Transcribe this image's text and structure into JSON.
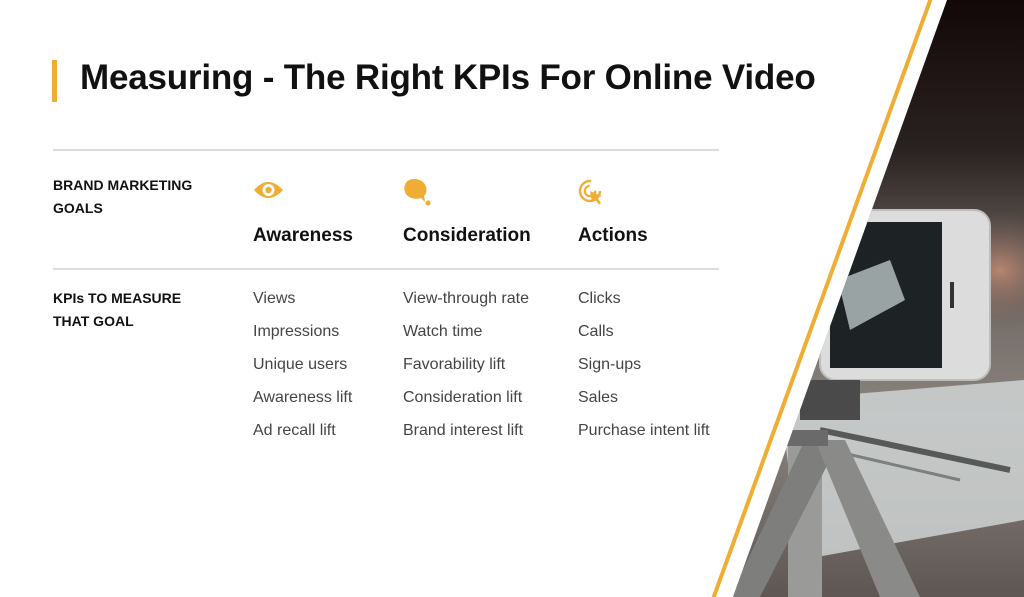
{
  "slide": {
    "title": "Measuring - The Right KPIs For Online Video",
    "accent_color": "#f0ad33"
  },
  "rows": {
    "goals_label": [
      "BRAND MARKETING",
      "GOALS"
    ],
    "kpis_label": [
      "KPIs TO MEASURE",
      "THAT GOAL"
    ]
  },
  "columns": [
    {
      "icon": "eye-icon",
      "goal": "Awareness",
      "kpis": [
        "Views",
        "Impressions",
        "Unique users",
        "Awareness lift",
        "Ad recall lift"
      ]
    },
    {
      "icon": "thought-bubble-icon",
      "goal": "Consideration",
      "kpis": [
        "View-through rate",
        "Watch time",
        "Favorability lift",
        "Consideration lift",
        "Brand interest lift"
      ]
    },
    {
      "icon": "cursor-click-target-icon",
      "goal": "Actions",
      "kpis": [
        "Clicks",
        "Calls",
        "Sign-ups",
        "Sales",
        "Purchase intent lift"
      ]
    }
  ],
  "image": {
    "description": "smartphone on tripod recording a laptop"
  }
}
